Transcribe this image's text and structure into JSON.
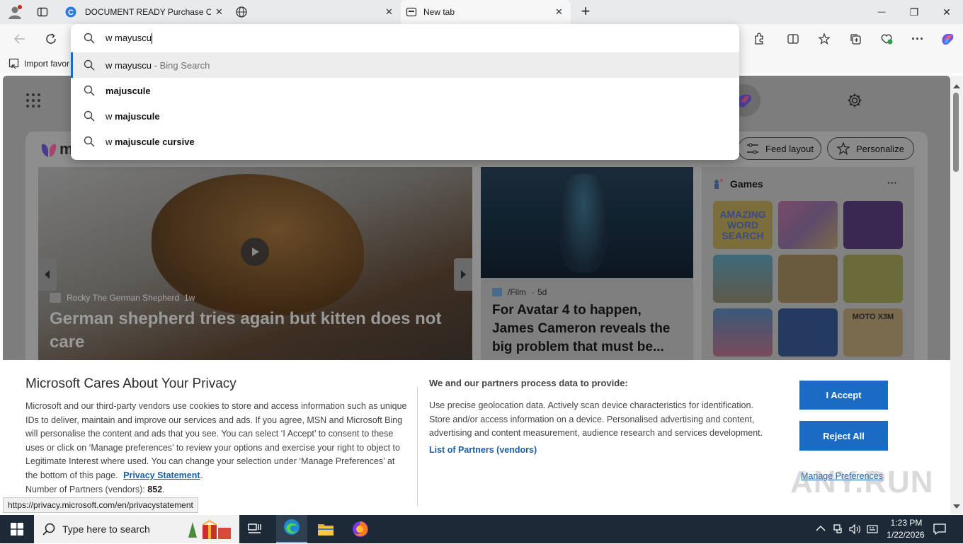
{
  "tabs": [
    {
      "title": "DOCUMENT READY Purchase Ord",
      "close": "✕"
    },
    {
      "title": "",
      "close": "✕"
    },
    {
      "title": "New tab",
      "close": "✕"
    }
  ],
  "new_tab_symbol": "+",
  "window_controls": {
    "minimize": "—",
    "restore": "❐",
    "close": "✕"
  },
  "address": {
    "value": "w mayuscu"
  },
  "suggestions": [
    {
      "plain": "w mayuscu",
      "bold": "",
      "suffix": " - Bing Search"
    },
    {
      "plain": "",
      "bold": "majuscule",
      "suffix": ""
    },
    {
      "plain": "w ",
      "bold": "majuscule",
      "suffix": ""
    },
    {
      "plain": "w ",
      "bold": "majuscule cursive",
      "suffix": ""
    }
  ],
  "favorites": {
    "import_label": "Import favor"
  },
  "newtab": {
    "feed_layout_label": "Feed layout",
    "personalize_label": "Personalize",
    "logo_letter": "m",
    "hero": {
      "source": "Rocky The German Shepherd",
      "age": "1w",
      "headline": "German shepherd tries again but kitten does not care"
    },
    "story2": {
      "source": "/Film",
      "age": "5d",
      "headline": "For Avatar 4 to happen, James Cameron reveals the big problem that must be..."
    },
    "games": {
      "title": "Games",
      "more": "···",
      "tile1_text": "AMAZING WORD SEARCH",
      "tile9_text": "MOTO X3M"
    }
  },
  "cookie": {
    "title": "Microsoft Cares About Your Privacy",
    "body": "Microsoft and our third-party vendors use cookies to store and access information such as unique IDs to deliver, maintain and improve our services and ads. If you agree, MSN and Microsoft Bing will personalise the content and ads that you see. You can select ‘I Accept’ to consent to these uses or click on ‘Manage preferences’ to review your options and exercise your right to object to Legitimate Interest where used.  You can change your selection under ‘Manage Preferences’ at the bottom of this page.",
    "privacy_link": "Privacy Statement",
    "partners_label": "Number of Partners (vendors): ",
    "partners_count": "852",
    "data_title": "We and our partners process data to provide:",
    "data_body": "Use precise geolocation data. Actively scan device characteristics for identification. Store and/or access information on a device. Personalised advertising and content, advertising and content measurement, audience research and services development.",
    "list_partners": "List of Partners (vendors)",
    "accept": "I Accept",
    "reject": "Reject All",
    "manage": "Manage Preferences"
  },
  "status_url": "https://privacy.microsoft.com/en/privacystatement",
  "taskbar": {
    "search_placeholder": "Type here to search",
    "time": "1:23 PM",
    "date": "1/22/2026"
  },
  "watermark": "ANY.RUN",
  "colors": {
    "accent_blue": "#1a6bc4",
    "taskbar": "#1c2a38"
  }
}
